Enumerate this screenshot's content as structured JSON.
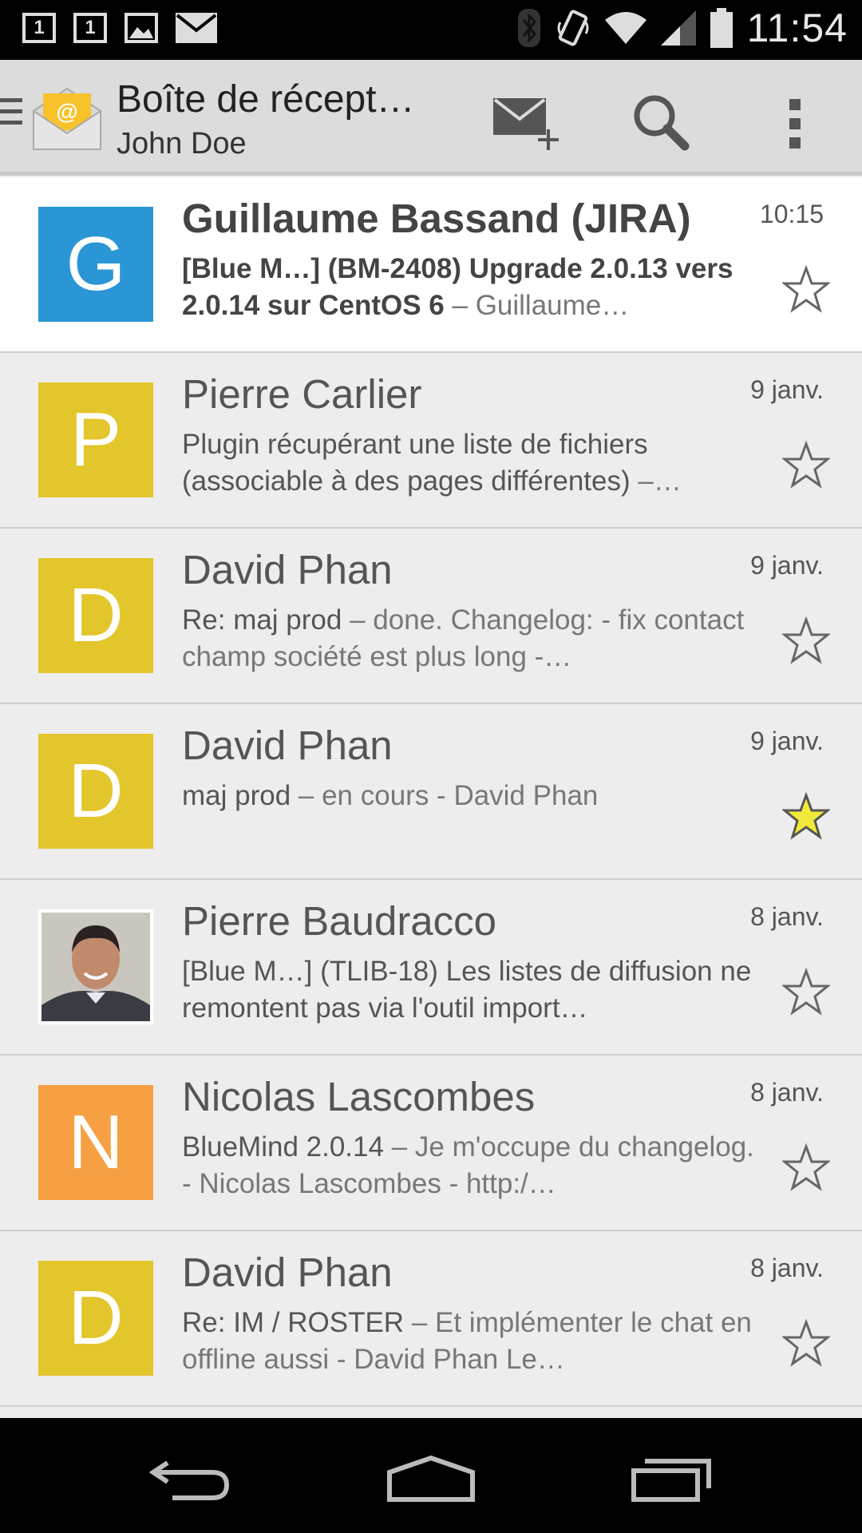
{
  "status_bar": {
    "notif_1": "1",
    "notif_2": "1",
    "time": "11:54",
    "icons": [
      "calendar-icon",
      "calendar-icon",
      "image-icon",
      "mail-icon",
      "bluetooth-icon",
      "vibrate-icon",
      "wifi-icon",
      "signal-icon",
      "battery-icon"
    ]
  },
  "action_bar": {
    "title": "Boîte de récept…",
    "account": "John Doe",
    "actions": [
      "compose-icon",
      "search-icon",
      "overflow-menu-icon"
    ]
  },
  "colors": {
    "blue": "#2a96d5",
    "yellow": "#e3c52c",
    "orange": "#f7a043",
    "star_filled": "#f2ea3a"
  },
  "messages": [
    {
      "initial": "G",
      "color": "#2a96d5",
      "sender": "Guillaume Bassand (JIRA)",
      "date": "10:15",
      "subject": "[Blue M…] (BM-2408) Upgrade 2.0.13 vers 2.0.14 sur CentOS 6",
      "sep": " – ",
      "preview": "Guillaume…",
      "unread": true,
      "starred": false
    },
    {
      "initial": "P",
      "color": "#e3c52c",
      "sender": "Pierre Carlier",
      "date": "9 janv.",
      "subject": "Plugin récupérant une liste de fichiers (associable à des pages différentes)",
      "sep": " –",
      "preview": "…",
      "unread": false,
      "starred": false
    },
    {
      "initial": "D",
      "color": "#e3c52c",
      "sender": "David Phan",
      "date": "9 janv.",
      "subject": "Re: maj prod",
      "sep": " – ",
      "preview": "done. Changelog: - fix contact champ société est plus long -…",
      "unread": false,
      "starred": false
    },
    {
      "initial": "D",
      "color": "#e3c52c",
      "sender": "David Phan",
      "date": "9 janv.",
      "subject": "maj prod",
      "sep": " – ",
      "preview": "en cours - David Phan",
      "unread": false,
      "starred": true
    },
    {
      "initial": "",
      "color": "photo",
      "sender": "Pierre Baudracco",
      "date": "8 janv.",
      "subject": "[Blue M…] (TLIB-18) Les listes de diffusion ne remontent pas via l'outil import…",
      "sep": "",
      "preview": "",
      "unread": false,
      "starred": false
    },
    {
      "initial": "N",
      "color": "#f7a043",
      "sender": "Nicolas Lascombes",
      "date": "8 janv.",
      "subject": "BlueMind 2.0.14",
      "sep": " – ",
      "preview": "Je m'occupe du changelog. - Nicolas Lascombes - http:/…",
      "unread": false,
      "starred": false
    },
    {
      "initial": "D",
      "color": "#e3c52c",
      "sender": "David Phan",
      "date": "8 janv.",
      "subject": "Re: IM / ROSTER",
      "sep": " – ",
      "preview": "Et implémenter le chat en offline aussi - David Phan Le…",
      "unread": false,
      "starred": false
    }
  ],
  "nav_bar": [
    "back-icon",
    "home-icon",
    "recents-icon"
  ]
}
